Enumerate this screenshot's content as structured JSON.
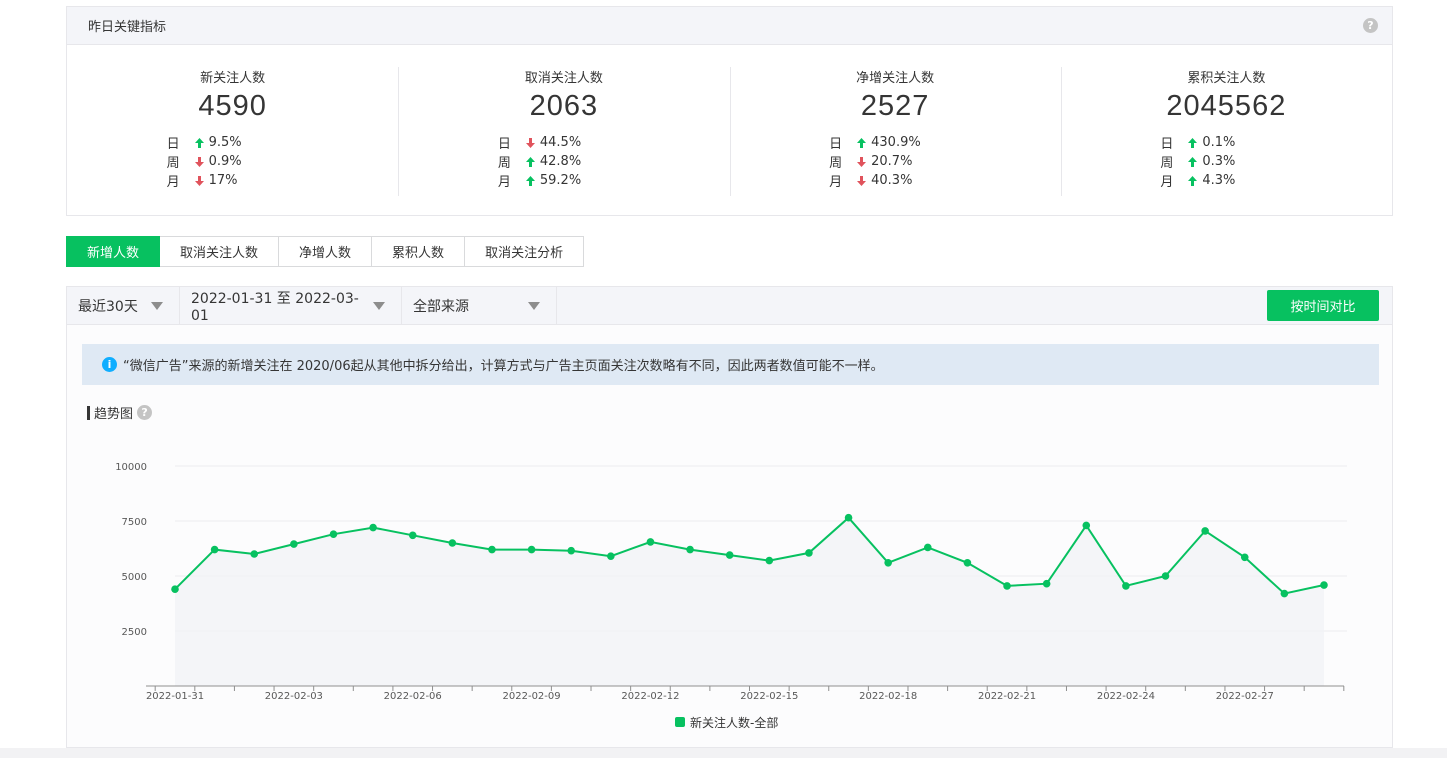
{
  "summary": {
    "title": "昨日关键指标",
    "help_icon": "question-circle-icon",
    "metrics": [
      {
        "label": "新关注人数",
        "value": "4590",
        "rows": [
          {
            "period": "日",
            "dir": "up",
            "pct": "9.5%"
          },
          {
            "period": "周",
            "dir": "down",
            "pct": "0.9%"
          },
          {
            "period": "月",
            "dir": "down",
            "pct": "17%"
          }
        ]
      },
      {
        "label": "取消关注人数",
        "value": "2063",
        "rows": [
          {
            "period": "日",
            "dir": "down",
            "pct": "44.5%"
          },
          {
            "period": "周",
            "dir": "up",
            "pct": "42.8%"
          },
          {
            "period": "月",
            "dir": "up",
            "pct": "59.2%"
          }
        ]
      },
      {
        "label": "净增关注人数",
        "value": "2527",
        "rows": [
          {
            "period": "日",
            "dir": "up",
            "pct": "430.9%"
          },
          {
            "period": "周",
            "dir": "down",
            "pct": "20.7%"
          },
          {
            "period": "月",
            "dir": "down",
            "pct": "40.3%"
          }
        ]
      },
      {
        "label": "累积关注人数",
        "value": "2045562",
        "rows": [
          {
            "period": "日",
            "dir": "up",
            "pct": "0.1%"
          },
          {
            "period": "周",
            "dir": "up",
            "pct": "0.3%"
          },
          {
            "period": "月",
            "dir": "up",
            "pct": "4.3%"
          }
        ]
      }
    ]
  },
  "tabs": [
    "新增人数",
    "取消关注人数",
    "净增人数",
    "累积人数",
    "取消关注分析"
  ],
  "active_tab": 0,
  "filters": {
    "range": "最近30天",
    "dates": "2022-01-31 至 2022-03-01",
    "source": "全部来源",
    "compare_button": "按时间对比"
  },
  "notice": "“微信广告”来源的新增关注在 2020/06起从其他中拆分给出，计算方式与广告主页面关注次数略有不同，因此两者数值可能不一样。",
  "trend_title": "趋势图",
  "colors": {
    "accent": "#07c160",
    "up": "#07c160",
    "down": "#e0535c",
    "info": "#10aeff"
  },
  "chart_data": {
    "type": "line",
    "ylim": [
      0,
      10000
    ],
    "yticks": [
      2500,
      5000,
      7500,
      10000
    ],
    "x": [
      "2022-01-31",
      "2022-02-01",
      "2022-02-02",
      "2022-02-03",
      "2022-02-04",
      "2022-02-05",
      "2022-02-06",
      "2022-02-07",
      "2022-02-08",
      "2022-02-09",
      "2022-02-10",
      "2022-02-11",
      "2022-02-12",
      "2022-02-13",
      "2022-02-14",
      "2022-02-15",
      "2022-02-16",
      "2022-02-17",
      "2022-02-18",
      "2022-02-19",
      "2022-02-20",
      "2022-02-21",
      "2022-02-22",
      "2022-02-23",
      "2022-02-24",
      "2022-02-25",
      "2022-02-26",
      "2022-02-27",
      "2022-02-28",
      "2022-03-01"
    ],
    "xtick_labels": [
      "2022-01-31",
      "2022-02-03",
      "2022-02-06",
      "2022-02-09",
      "2022-02-12",
      "2022-02-15",
      "2022-02-18",
      "2022-02-21",
      "2022-02-24",
      "2022-02-27"
    ],
    "series": [
      {
        "name": "新关注人数-全部",
        "color": "#07c160",
        "values": [
          4400,
          6200,
          6000,
          6450,
          6900,
          7200,
          6850,
          6500,
          6200,
          6200,
          6150,
          5900,
          6550,
          6200,
          5950,
          5700,
          6050,
          7650,
          5600,
          6300,
          5600,
          4550,
          4650,
          7300,
          4550,
          5000,
          7050,
          5850,
          4200,
          4590
        ]
      }
    ],
    "grid": true,
    "legend": "bottom-center"
  }
}
